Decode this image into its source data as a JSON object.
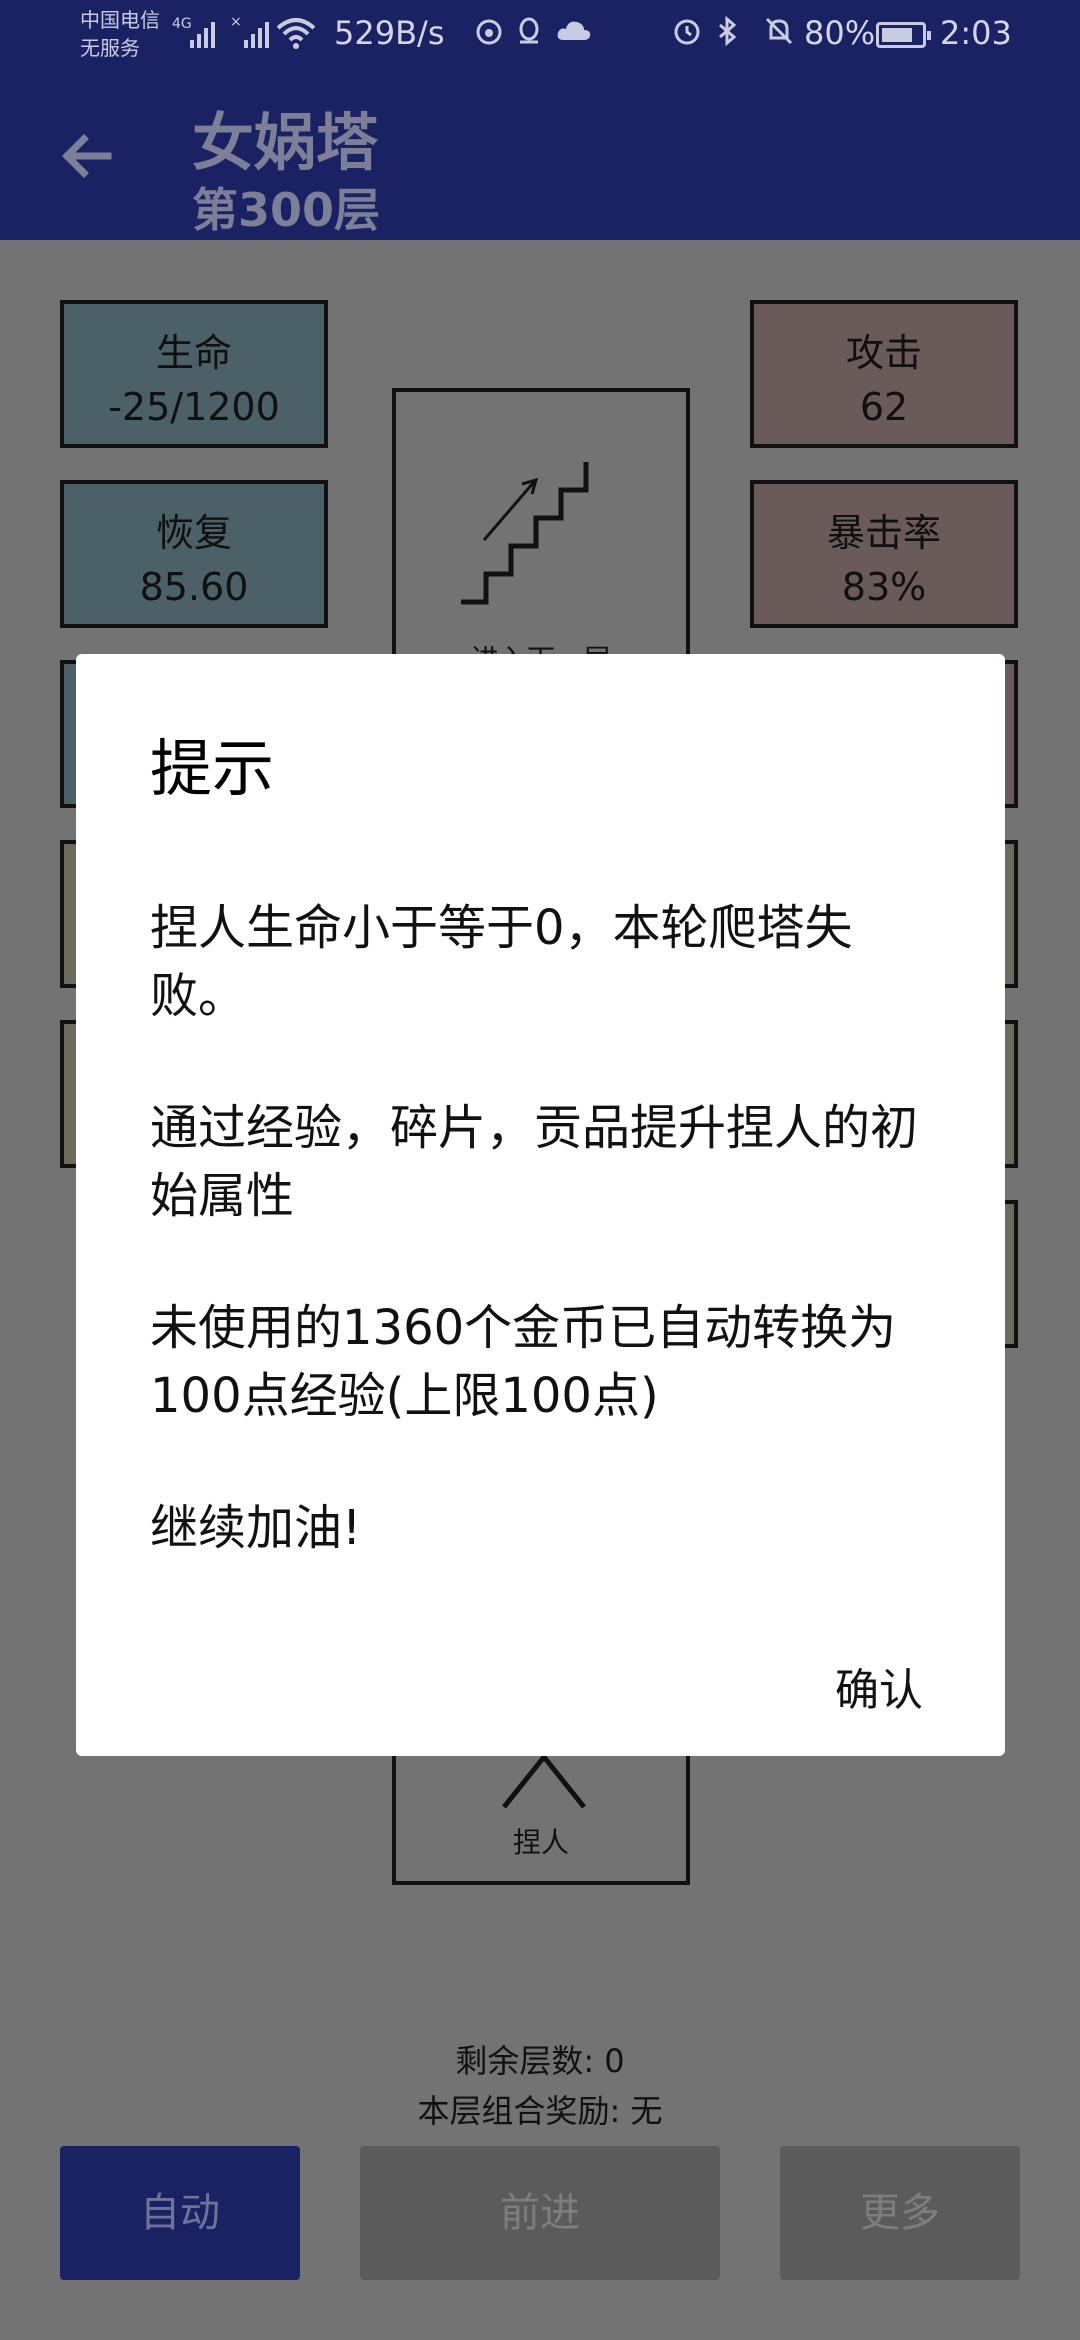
{
  "status_bar": {
    "carrier_line1": "中国电信",
    "carrier_line2": "无服务",
    "network": "4G",
    "net_speed": "529B/s",
    "battery_percent": "80%",
    "battery_level": 0.8,
    "time": "2:03"
  },
  "app_bar": {
    "title": "女娲塔",
    "subtitle": "第300层"
  },
  "stats": {
    "life_label": "生命",
    "life_value": "-25/1200",
    "regen_label": "恢复",
    "regen_value": "85.60",
    "attack_label": "攻击",
    "attack_value": "62",
    "crit_label": "暴击率",
    "crit_value": "83%"
  },
  "center": {
    "stairs_label": "进入下一层",
    "player_label": "捏人"
  },
  "info": {
    "remaining_floors": "剩余层数: 0",
    "floor_reward": "本层组合奖励: 无"
  },
  "buttons": {
    "auto": "自动",
    "forward": "前进",
    "more": "更多"
  },
  "dialog": {
    "title": "提示",
    "line1": "捏人生命小于等于0，本轮爬塔失败。",
    "line2": "通过经验，碎片，贡品提升捏人的初始属性",
    "line3": "未使用的1360个金币已自动转换为100点经验(上限100点)",
    "line4": "继续加油!",
    "confirm": "确认"
  },
  "colors": {
    "primary": "#1b2263",
    "overlay": "#737373"
  }
}
